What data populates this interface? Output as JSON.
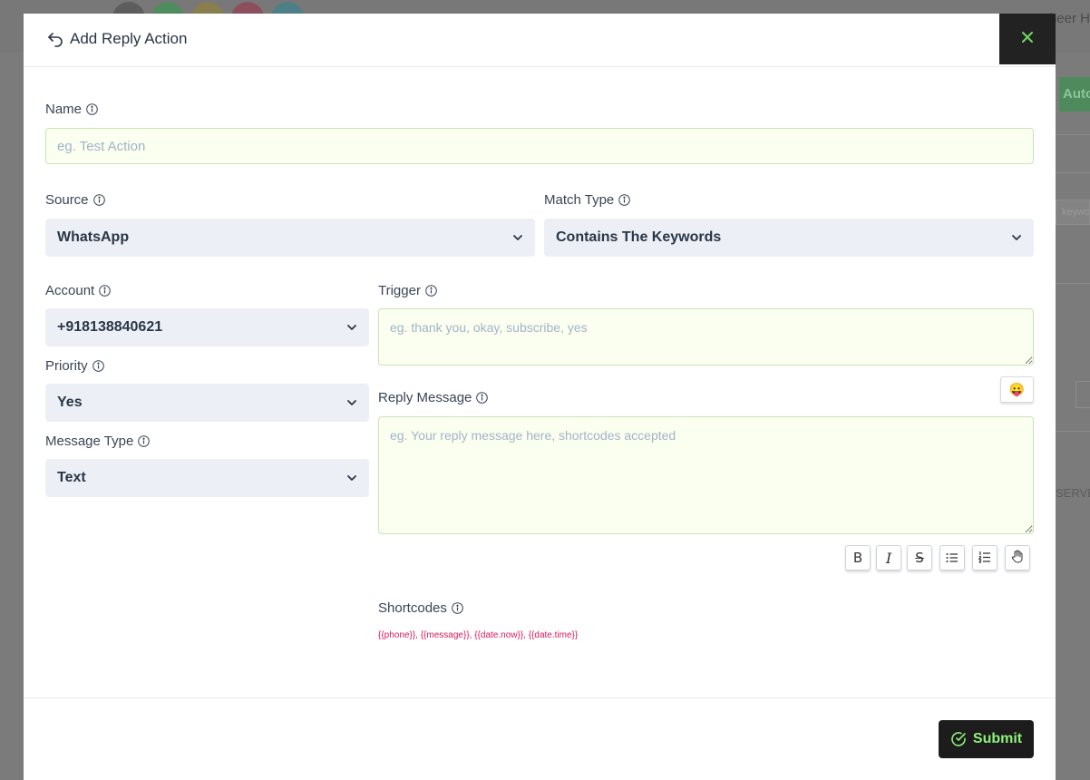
{
  "background": {
    "user_name": "heer H",
    "right_button_label": "Auto",
    "right_input_text": "keyword",
    "right_column_text": "SERVE"
  },
  "modal": {
    "title": "Add Reply Action",
    "close_icon": "close-icon",
    "back_icon": "undo-arrow-icon"
  },
  "form": {
    "name": {
      "label": "Name",
      "placeholder": "eg. Test Action"
    },
    "source": {
      "label": "Source",
      "value": "WhatsApp"
    },
    "match_type": {
      "label": "Match Type",
      "value": "Contains The Keywords"
    },
    "account": {
      "label": "Account",
      "value": "+918138840621"
    },
    "priority": {
      "label": "Priority",
      "value": "Yes"
    },
    "message_type": {
      "label": "Message Type",
      "value": "Text"
    },
    "trigger": {
      "label": "Trigger",
      "placeholder": "eg. thank you, okay, subscribe, yes"
    },
    "reply_message": {
      "label": "Reply Message",
      "placeholder": "eg. Your reply message here, shortcodes accepted"
    },
    "emoji_button": "😛",
    "toolbar": {
      "bold": "B",
      "italic": "I",
      "strike": "S"
    },
    "shortcodes": {
      "label": "Shortcodes",
      "text": "{{phone}}, {{message}}, {{date.now}}, {{date.time}}"
    }
  },
  "footer": {
    "submit_label": "Submit"
  },
  "colors": {
    "accent_green": "#8ef07a",
    "shortcode_pink": "#d81b5a",
    "input_bg": "#fafff0",
    "select_bg": "#ecf0f6"
  }
}
